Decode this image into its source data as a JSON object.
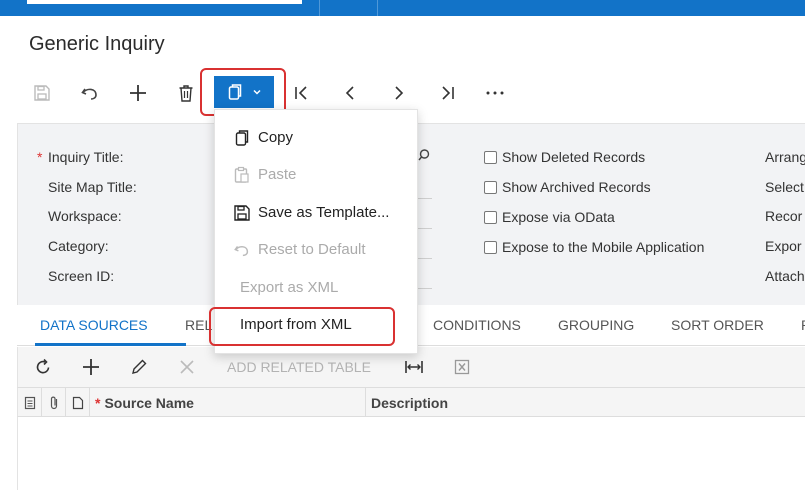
{
  "page": {
    "title": "Generic Inquiry"
  },
  "toolbar": {
    "save_icon": "save-icon",
    "undo_icon": "undo-icon",
    "add_icon": "plus-icon",
    "delete_icon": "trash-icon",
    "clipboard_icon": "clipboard-icon",
    "first_icon": "first-page-icon",
    "prev_icon": "chevron-left-icon",
    "next_icon": "chevron-right-icon",
    "last_icon": "last-page-icon",
    "more_icon": "more-icon"
  },
  "form": {
    "inquiry_title_label": "Inquiry Title:",
    "required_mark": "*",
    "site_map_title_label": "Site Map Title:",
    "workspace_label": "Workspace:",
    "category_label": "Category:",
    "screen_id_label": "Screen ID:",
    "show_deleted": "Show Deleted Records",
    "show_archived": "Show Archived Records",
    "expose_odata": "Expose via OData",
    "expose_mobile": "Expose to the Mobile Application",
    "right_labels": [
      "Arrang",
      "Select",
      "Recor",
      "Expor",
      "Attach"
    ]
  },
  "menu": {
    "items": [
      {
        "label": "Copy",
        "icon": "copy-icon",
        "disabled": false
      },
      {
        "label": "Paste",
        "icon": "paste-icon",
        "disabled": true
      },
      {
        "label": "Save as Template...",
        "icon": "save-icon",
        "disabled": false
      },
      {
        "label": "Reset to Default",
        "icon": "reset-icon",
        "disabled": true
      },
      {
        "label": "Export as XML",
        "icon": "",
        "disabled": true
      },
      {
        "label": "Import from XML",
        "icon": "",
        "disabled": false
      }
    ]
  },
  "tabs": {
    "data_sources": "DATA SOURCES",
    "relations_partial": "REL",
    "conditions": "CONDITIONS",
    "grouping": "GROUPING",
    "sort_order": "SORT ORDER",
    "next_partial": "R"
  },
  "grid": {
    "add_related_table": "ADD RELATED TABLE",
    "required_mark": "*",
    "col_source_name": "Source Name",
    "col_description": "Description"
  },
  "colors": {
    "accent": "#1273c8",
    "highlight": "#d93131"
  }
}
